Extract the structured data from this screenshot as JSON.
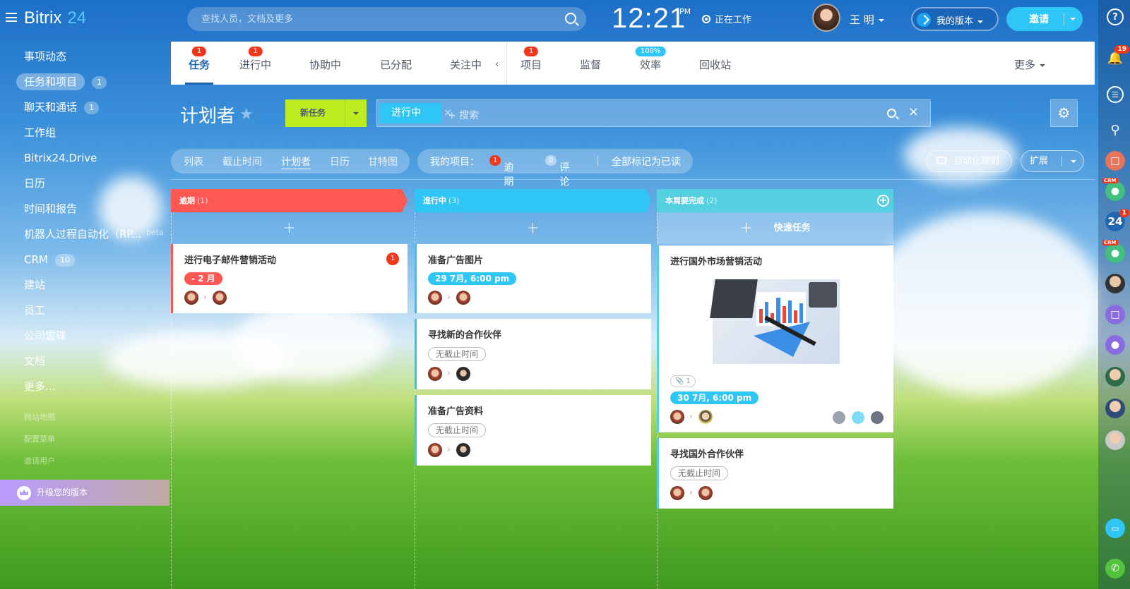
{
  "app": {
    "logo_main": "Bitrix",
    "logo_num": "24"
  },
  "header": {
    "search_placeholder": "查找人员，文档及更多",
    "time": "12:21",
    "ampm": "PM",
    "work_status": "正在工作",
    "user_name": "王 明",
    "my_plan": "我的版本",
    "invite": "邀请"
  },
  "sidebar": {
    "items": [
      {
        "label": "事项动态"
      },
      {
        "label": "任务和项目",
        "count": "1",
        "active": true
      },
      {
        "label": "聊天和通话",
        "count": "1"
      },
      {
        "label": "工作组"
      },
      {
        "label": "Bitrix24.Drive"
      },
      {
        "label": "日历"
      },
      {
        "label": "时间和报告"
      },
      {
        "label": "机器人过程自动化（RP...",
        "tag": "beta"
      },
      {
        "label": "CRM",
        "count": "10"
      },
      {
        "label": "建站"
      },
      {
        "label": "员工"
      },
      {
        "label": "公司雲碟"
      },
      {
        "label": "文档"
      },
      {
        "label": "更多..."
      }
    ],
    "small_items": [
      "网站地图",
      "配置菜单",
      "邀请用户"
    ],
    "upgrade": "升级您的版本"
  },
  "tabs": {
    "items": [
      {
        "label": "任务",
        "badge": "1"
      },
      {
        "label": "进行中",
        "badge": "1"
      },
      {
        "label": "协助中"
      },
      {
        "label": "已分配"
      },
      {
        "label": "关注中"
      },
      {
        "label": "项目",
        "badge": "1"
      },
      {
        "label": "监督"
      },
      {
        "label": "效率",
        "badge": "100%"
      },
      {
        "label": "回收站"
      }
    ],
    "more": "更多"
  },
  "toolbar": {
    "title": "计划者",
    "new_task": "新任务",
    "filter_chip": "进行中",
    "filter_placeholder": "+ 搜索"
  },
  "views": {
    "items": [
      "列表",
      "截止时间",
      "计划者",
      "日历",
      "甘特图"
    ],
    "active": "计划者"
  },
  "counters": {
    "label": "我的项目：",
    "overdue_count": "1",
    "overdue_label": "逾期",
    "comments_count": "0",
    "comments_label": "评论",
    "mark_all": "全部标记为已读"
  },
  "actions": {
    "automation": "自动化规则",
    "expand": "扩展"
  },
  "columns": [
    {
      "title": "逾期",
      "count": "(1)",
      "color": "#ff5752",
      "cards": [
        {
          "title": "进行电子邮件营销活动",
          "deadline": "- 2 月",
          "kind": "overdue",
          "badge": "1"
        }
      ]
    },
    {
      "title": "進行中",
      "count": "(3)",
      "color": "#2fc6f6",
      "cards": [
        {
          "title": "准备广告图片",
          "deadline": "29 7月, 6:00 pm",
          "kind": "ok"
        },
        {
          "title": "寻找新的合作伙伴",
          "deadline": "无截止时间",
          "kind": "none"
        },
        {
          "title": "准备广告资料",
          "deadline": "无截止时间",
          "kind": "none"
        }
      ]
    },
    {
      "title": "本周要完成",
      "count": "(2)",
      "color": "#55d0e0",
      "quick_add": "快速任务",
      "cards": [
        {
          "title": "进行国外市场营销活动",
          "deadline": "30 7月, 6:00 pm",
          "kind": "ok",
          "attachments": "1"
        },
        {
          "title": "寻找国外合作伙伴",
          "deadline": "无截止时间",
          "kind": "none"
        }
      ]
    }
  ],
  "right_rail": {
    "notifications": "19",
    "b24_badge": "1",
    "crm_tag": "CRM",
    "b24_label": "24"
  },
  "colors": {
    "accent": "#2fc6f6",
    "new_task": "#bbed21",
    "overdue": "#ff5752",
    "active_tab": "#2066b0"
  }
}
